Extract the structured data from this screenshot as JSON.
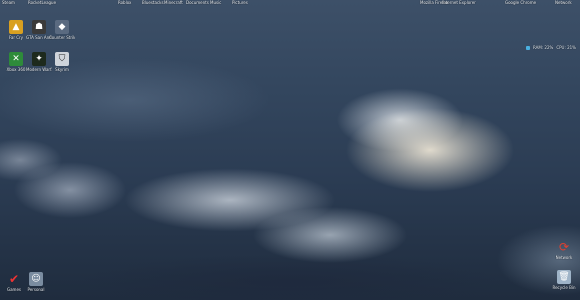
{
  "top_row": [
    {
      "label": "Steam",
      "icon": "steam-icon"
    },
    {
      "label": "RocketLeague",
      "icon": "game-icon"
    },
    {
      "label": "Roblox",
      "icon": "roblox-icon"
    },
    {
      "label": "Bluestacks",
      "icon": "bluestacks-icon"
    },
    {
      "label": "Minecraft",
      "icon": "minecraft-icon"
    },
    {
      "label": "Documents",
      "icon": "folder-icon"
    },
    {
      "label": "Music",
      "icon": "music-icon"
    },
    {
      "label": "Pictures",
      "icon": "pictures-icon"
    },
    {
      "label": "Mozilla Firefox",
      "icon": "firefox-icon"
    },
    {
      "label": "Internet Explorer",
      "icon": "ie-icon"
    },
    {
      "label": "Google Chrome",
      "icon": "chrome-icon"
    },
    {
      "label": "Network",
      "icon": "network-icon"
    }
  ],
  "left_column": [
    {
      "label": "Far Cry",
      "icon": "game-icon"
    },
    {
      "label": "GTA San Andreas",
      "icon": "game-icon"
    },
    {
      "label": "Counter Strike",
      "icon": "game-icon"
    },
    {
      "label": "Xbox 360",
      "icon": "xbox-icon"
    },
    {
      "label": "Modern Warfare",
      "icon": "game-icon"
    },
    {
      "label": "Skyrim",
      "icon": "skyrim-icon"
    }
  ],
  "bottom_left": [
    {
      "label": "Games",
      "icon": "checkmark-icon"
    },
    {
      "label": "Personal",
      "icon": "user-icon"
    }
  ],
  "bottom_right": [
    {
      "label": "Network",
      "icon": "network-icon"
    },
    {
      "label": "Recycle Bin",
      "icon": "recycle-bin-icon"
    }
  ],
  "meter": {
    "ram": "RAM: 22%",
    "cpu": "CPU: 21%"
  },
  "colors": {
    "sky_top": "#3d5068",
    "sky_bottom": "#1f2c3e",
    "cloud": "#f3ece0"
  }
}
